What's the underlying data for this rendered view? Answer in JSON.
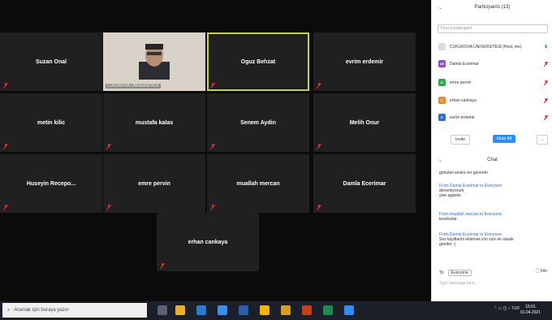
{
  "gallery": {
    "tiles": [
      {
        "name": "Suzan Onal"
      },
      {
        "caption": "CUKUROVA ÜNİVERSİTESİ"
      },
      {
        "name": "Oguz Behzat"
      },
      {
        "name": "evrim erdemir"
      },
      {
        "name": "metin kilic"
      },
      {
        "name": "mustafa kalas"
      },
      {
        "name": "Senem Aydin"
      },
      {
        "name": "Melih Onur"
      },
      {
        "name": "Huseyin Recepo..."
      },
      {
        "name": "emre pervin"
      },
      {
        "name": "muallah mercan"
      },
      {
        "name": "Damla Ecerimar"
      },
      {
        "name": "erhan cankaya"
      }
    ]
  },
  "participants_panel": {
    "title": "Participants (13)",
    "search_placeholder": "Find a participant",
    "items": [
      {
        "label": "CUKUROVA ÜNİVERSİTESİ (Host, me)",
        "initials": "",
        "color": "#d9dde3"
      },
      {
        "label": "Damla Ecerimar",
        "initials": "DE",
        "color": "#8e4ec6"
      },
      {
        "label": "emre pervin",
        "initials": "E",
        "color": "#2fa84f"
      },
      {
        "label": "erhan cankaya",
        "initials": "E",
        "color": "#e98a24"
      },
      {
        "label": "evrim erdemir",
        "initials": "E",
        "color": "#2d6bd1"
      }
    ],
    "invite_label": "Invite",
    "mute_all_label": "Mute All",
    "more_label": "..."
  },
  "chat": {
    "title": "Chat",
    "messages": [
      {
        "from": "",
        "text": "gonulan sesini ver gonerim"
      },
      {
        "from": "From Damla Ecerimar to Everyone:",
        "text": "denemiyorum\nyine agamin"
      },
      {
        "from": "From muallah mercan to Everyone:",
        "text": "tesekurlar"
      },
      {
        "from": "From Damla Ecerimar to Everyone:",
        "text": "Ses kayitlarini eklemek icin size ek olarak\ngonder :)"
      }
    ],
    "to_label": "To:",
    "to_value": "Everyone",
    "file_label": "File",
    "input_placeholder": "Type message here..."
  },
  "taskbar": {
    "search_text": "Aramak için buraya yazın",
    "time": "15:01",
    "date": "01.04.2021"
  },
  "colors": {
    "active_speaker": "#c8d14a",
    "mic_muted": "#e02a36",
    "mute_all_button": "#2d8cff"
  }
}
